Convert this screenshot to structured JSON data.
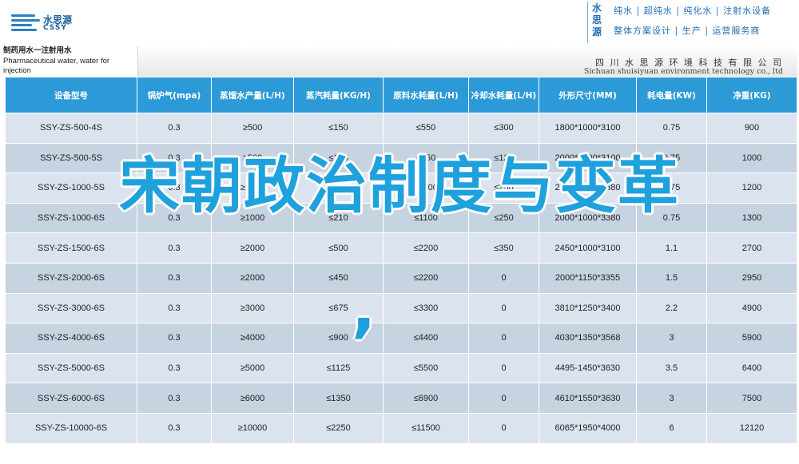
{
  "brand": {
    "logo_cn": "水思源",
    "logo_en": "CSSY",
    "vertical_name": "水思源",
    "slogan_line1": "纯水 | 超纯水 | 纯化水 | 注射水设备",
    "slogan_line2": "整体方案设计 | 生产 | 运营服务商",
    "company_cn": "四 川 水 思 源 环 境 科 技 有 限 公 司",
    "company_en": "Sichuan shuisiyuan environment technology co., ltd"
  },
  "table_caption": "制药用水一注射用水\nPharmaceutical water, water for injection",
  "table": {
    "headers": [
      "设备型号",
      "锅炉气(mpa)",
      "蒸馏水产量(L/H)",
      "蒸汽耗量(KG/H)",
      "原料水耗量(L/H)",
      "冷却水耗量(L/H)",
      "外形尺寸(MM)",
      "耗电量(KW)",
      "净重(KG)"
    ],
    "rows": [
      [
        "SSY-ZS-500-4S",
        "0.3",
        "≥500",
        "≤150",
        "≤550",
        "≤300",
        "1800*1000*3100",
        "0.75",
        "900"
      ],
      [
        "SSY-ZS-500-5S",
        "0.3",
        "≥500",
        "≤125",
        "≤550",
        "≤120",
        "2000*1000*3100",
        "0.75",
        "1000"
      ],
      [
        "SSY-ZS-1000-5S",
        "0.3",
        "≥1000",
        "≤245",
        "≤1100",
        "≤250",
        "2000*1000*3380",
        "0.75",
        "1200"
      ],
      [
        "SSY-ZS-1000-6S",
        "0.3",
        "≥1000",
        "≤210",
        "≤1100",
        "≤250",
        "2000*1000*3380",
        "0.75",
        "1300"
      ],
      [
        "SSY-ZS-1500-6S",
        "0.3",
        "≥2000",
        "≤500",
        "≤2200",
        "≤350",
        "2450*1000*3100",
        "1.1",
        "2700"
      ],
      [
        "SSY-ZS-2000-6S",
        "0.3",
        "≥2000",
        "≤450",
        "≤2200",
        "0",
        "2000*1150*3355",
        "1.5",
        "2950"
      ],
      [
        "SSY-ZS-3000-6S",
        "0.3",
        "≥3000",
        "≤675",
        "≤3300",
        "0",
        "3810*1250*3400",
        "2.2",
        "4900"
      ],
      [
        "SSY-ZS-4000-6S",
        "0.3",
        "≥4000",
        "≤900",
        "≤4400",
        "0",
        "4030*1350*3568",
        "3",
        "5900"
      ],
      [
        "SSY-ZS-5000-6S",
        "0.3",
        "≥5000",
        "≤1125",
        "≤5500",
        "0",
        "4495-1450*3630",
        "3.5",
        "6400"
      ],
      [
        "SSY-ZS-6000-6S",
        "0.3",
        "≥6000",
        "≤1350",
        "≤6900",
        "0",
        "4610*1550*3630",
        "3",
        "7500"
      ],
      [
        "SSY-ZS-10000-6S",
        "0.3",
        "≥10000",
        "≤2250",
        "≤11500",
        "0",
        "6065*1950*4000",
        "6",
        "12120"
      ]
    ]
  },
  "overlay": {
    "title": "宋朝政治制度与变革",
    "comma": ","
  },
  "colors": {
    "header_blue": "#2d9ad8",
    "row_light": "#dbe4ee",
    "row_dark": "#c6d3e0",
    "overlay_blue": "#1ea1dc"
  }
}
